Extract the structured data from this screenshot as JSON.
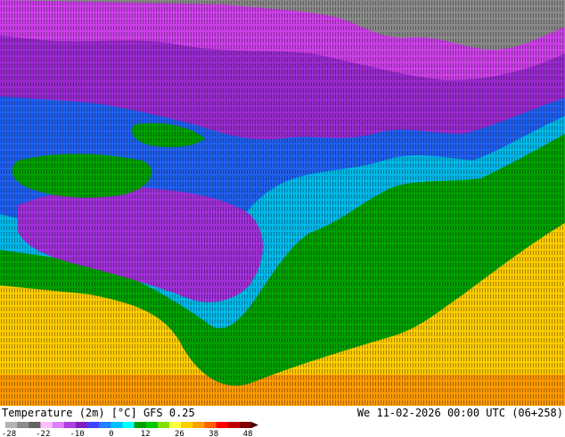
{
  "map": {
    "product": "Temperature (2m) [°C]",
    "model": "GFS 0.25",
    "valid_time": "We 11-02-2026 00:00 UTC (06+258)"
  },
  "legend": {
    "ticks": [
      "-28",
      "-22",
      "-10",
      "0",
      "12",
      "26",
      "38",
      "48"
    ],
    "colors": [
      "#b4b4b4",
      "#8c8c8c",
      "#646464",
      "#ffbfff",
      "#e080ff",
      "#b040e0",
      "#8020c0",
      "#4040ff",
      "#2080ff",
      "#00c0ff",
      "#00ffff",
      "#00a000",
      "#00c800",
      "#80e000",
      "#ffff40",
      "#ffd000",
      "#ffa000",
      "#ff6000",
      "#ff0000",
      "#c00000",
      "#800000"
    ]
  }
}
